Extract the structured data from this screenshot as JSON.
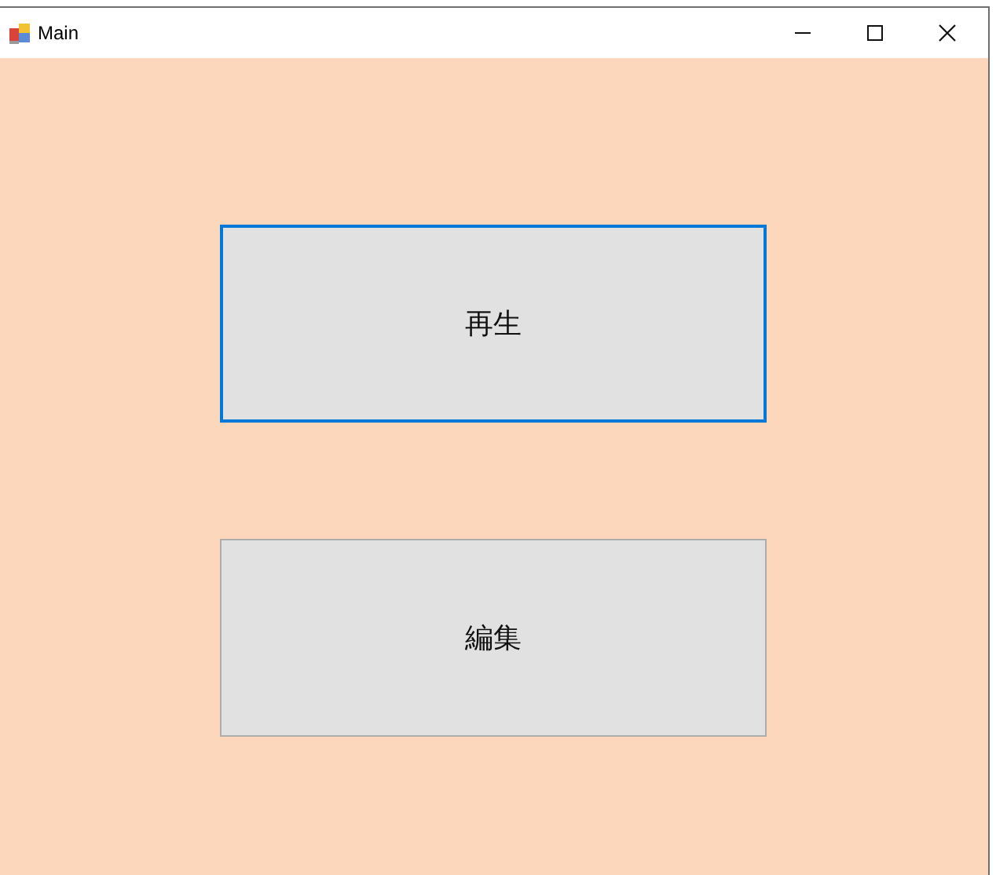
{
  "window": {
    "title": "Main"
  },
  "buttons": [
    {
      "label": "再生",
      "focused": true
    },
    {
      "label": "編集",
      "focused": false
    }
  ]
}
